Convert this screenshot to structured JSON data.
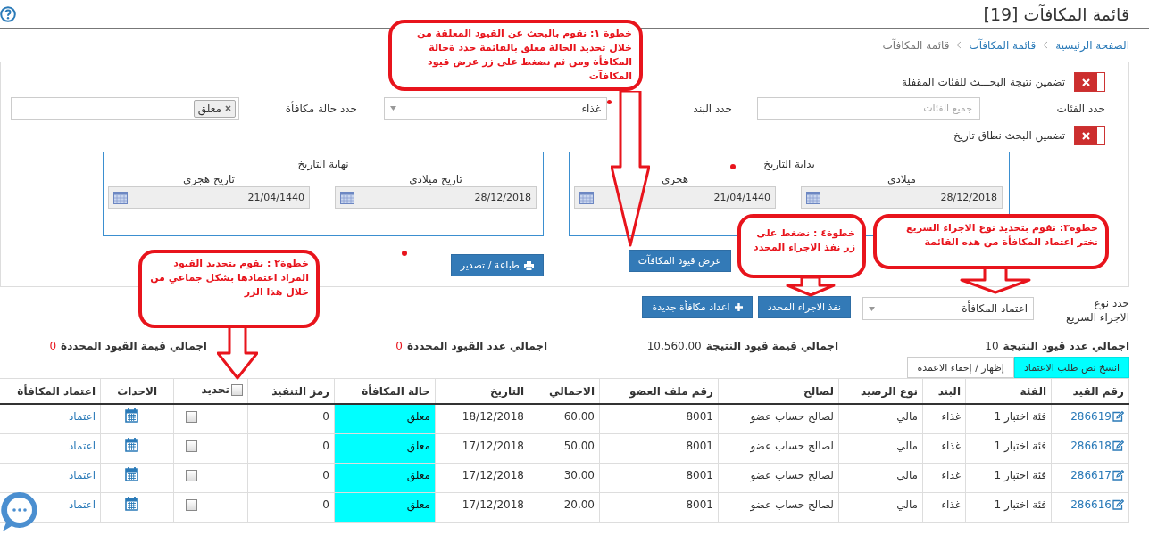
{
  "page": {
    "title": "قائمة المكافآت [19]"
  },
  "breadcrumb": [
    {
      "label": "الصفحة الرئيسية",
      "link": true
    },
    {
      "label": "قائمة المكافآت",
      "link": true
    },
    {
      "label": "قائمة المكافآت",
      "link": false
    }
  ],
  "filters": {
    "locked_toggle": {
      "label": "تضمين نتيجة البحـــث للفئات المقفلة",
      "on": false
    },
    "category": {
      "label": "حدد الفئات",
      "placeholder": "جميع الفئات"
    },
    "item": {
      "label": "حدد البند",
      "required": true,
      "value": "غذاء"
    },
    "status": {
      "label": "حدد حالة مكافأة",
      "tags": [
        "معلق"
      ]
    },
    "date_toggle": {
      "label": "تضمين البحث نطاق تاريخ",
      "on": false
    },
    "date_ranges": [
      {
        "title": "بداية التاريخ",
        "fields": [
          {
            "label": "ميلادي",
            "value": "28/12/2018"
          },
          {
            "label": "هجري",
            "value": "21/04/1440"
          }
        ]
      },
      {
        "title": "نهاية التاريخ",
        "fields": [
          {
            "label": "تاريخ ميلادي",
            "value": "28/12/2018"
          },
          {
            "label": "تاريخ هجري",
            "value": "21/04/1440"
          }
        ]
      }
    ],
    "show_button": "عرض قيود المكافآت",
    "print_button": "طباعة / تصدير"
  },
  "quick_action": {
    "label": "حدد نوع الاجراء السريع",
    "value": "اعتماد المكافأة",
    "run_button": "نفذ الاجراء المحدد",
    "new_button": "اعداد مكافأة جديدة"
  },
  "totals": [
    {
      "label": "اجمالي عدد قيود النتيجة",
      "value": "10",
      "alert": false
    },
    {
      "label": "اجمالي قيمة قيود النتيجة",
      "value": "10,560.00",
      "alert": false
    },
    {
      "label": "اجمالي عدد القيود المحددة",
      "value": "0",
      "alert": true
    },
    {
      "label": "اجمالي قيمة القيود المحددة",
      "value": "0",
      "alert": true
    }
  ],
  "table_tools": [
    {
      "label": "انسخ نص طلب الاعتماد",
      "highlighted": true
    },
    {
      "label": "إظهار / إخفاء الاعمدة",
      "highlighted": false
    }
  ],
  "table": {
    "columns": [
      {
        "label": "رقم القيد",
        "kind": "text"
      },
      {
        "label": "الفئة",
        "kind": "text"
      },
      {
        "label": "البند",
        "kind": "text"
      },
      {
        "label": "نوع الرصيد",
        "kind": "text"
      },
      {
        "label": "لصالح",
        "kind": "text"
      },
      {
        "label": "رقم ملف العضو",
        "kind": "text"
      },
      {
        "label": "الاجمالي",
        "kind": "text"
      },
      {
        "label": "التاريخ",
        "kind": "text"
      },
      {
        "label": "حالة المكافأة",
        "kind": "text"
      },
      {
        "label": "رمز التنفيذ",
        "kind": "text"
      },
      {
        "label": "تحديد",
        "kind": "select",
        "checked": false
      },
      {
        "kind": "spacer"
      },
      {
        "label": "الاحداث",
        "kind": "text"
      },
      {
        "label": "اعتماد المكافأة",
        "kind": "text"
      }
    ],
    "rows": [
      {
        "id": "286619",
        "category": "فئة اختبار 1",
        "item": "غذاء",
        "balance_type": "مالي",
        "beneficiary": "لصالح حساب عضو",
        "member_file": "8001",
        "total": "60.00",
        "date": "18/12/2018",
        "status": "معلق",
        "exec_code": "0",
        "checked": false,
        "action": "اعتماد"
      },
      {
        "id": "286618",
        "category": "فئة اختبار 1",
        "item": "غذاء",
        "balance_type": "مالي",
        "beneficiary": "لصالح حساب عضو",
        "member_file": "8001",
        "total": "50.00",
        "date": "17/12/2018",
        "status": "معلق",
        "exec_code": "0",
        "checked": false,
        "action": "اعتماد"
      },
      {
        "id": "286617",
        "category": "فئة اختبار 1",
        "item": "غذاء",
        "balance_type": "مالي",
        "beneficiary": "لصالح حساب عضو",
        "member_file": "8001",
        "total": "30.00",
        "date": "17/12/2018",
        "status": "معلق",
        "exec_code": "0",
        "checked": false,
        "action": "اعتماد"
      },
      {
        "id": "286616",
        "category": "فئة اختبار 1",
        "item": "غذاء",
        "balance_type": "مالي",
        "beneficiary": "لصالح حساب عضو",
        "member_file": "8001",
        "total": "20.00",
        "date": "17/12/2018",
        "status": "معلق",
        "exec_code": "0",
        "checked": false,
        "action": "اعتماد"
      }
    ]
  },
  "annotations": [
    {
      "text": "خطوة ١: نقوم بالبحث عن القيود المعلقة من خلال تحديد الحالة معلق بالقائمة حدد ةحالة المكافأة ومن ثم نضغط على زر عرض قيود المكافآت"
    },
    {
      "text": "خطوة٢ : نقوم بتحديد القيود المراد اعتمادها بشكل جماعي من خلال هذا الزر"
    },
    {
      "text": "خطوة٣: نقوم بتحديد نوع الاجراء السريع نختر اعتماد المكافأة من هذه القائمة"
    },
    {
      "text": "خطوة٤ : نضغط على زر نفذ الاجراء المحدد"
    }
  ]
}
